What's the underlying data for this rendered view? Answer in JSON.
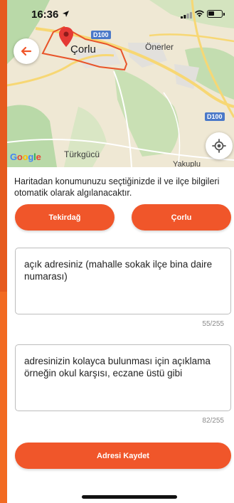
{
  "status_bar": {
    "time": "16:36"
  },
  "map": {
    "city_label": "Çorlu",
    "place_labels": [
      "Önerler",
      "Türkgücü",
      "Yakuplu"
    ],
    "road_badges": [
      "D100",
      "D100"
    ],
    "provider": "Google",
    "colors": {
      "land": "#efe8d4",
      "green": "#b9d9a8",
      "road": "#f7d774",
      "boundary": "#e8542a",
      "pin": "#e53935"
    }
  },
  "info_text": "Haritadan konumunuzu seçtiğinizde il ve ilçe bilgileri otomatik olarak algılanacaktır.",
  "province_button": "Tekirdağ",
  "district_button": "Çorlu",
  "address_field": {
    "value": "açık adresiniz (mahalle sokak ilçe bina daire numarası)",
    "counter": "55/255"
  },
  "description_field": {
    "value": "adresinizin kolayca bulunması için açıklama örneğin okul karşısı, eczane üstü gibi",
    "counter": "82/255"
  },
  "save_button": "Adresi Kaydet",
  "accent_color": "#f0562a",
  "icons": [
    "back-arrow-icon",
    "my-location-icon",
    "map-pin-icon",
    "location-arrow-icon",
    "cellular-signal-icon",
    "wifi-icon",
    "battery-icon"
  ]
}
